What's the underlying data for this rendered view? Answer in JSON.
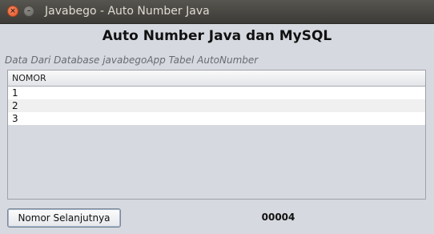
{
  "window": {
    "title": "Javabego - Auto Number Java",
    "close_glyph": "×",
    "minimize_glyph": "–"
  },
  "heading": "Auto Number Java dan MySQL",
  "subtitle": "Data Dari Database javabegoApp Tabel AutoNumber",
  "table": {
    "columns": [
      "NOMOR"
    ],
    "rows": [
      "1",
      "2",
      "3"
    ]
  },
  "actions": {
    "next_label": "Nomor Selanjutnya"
  },
  "next_number": "00004",
  "colors": {
    "titlebar": "#3c3b37",
    "close_button": "#e4562a",
    "window_background": "#d6d9df"
  }
}
